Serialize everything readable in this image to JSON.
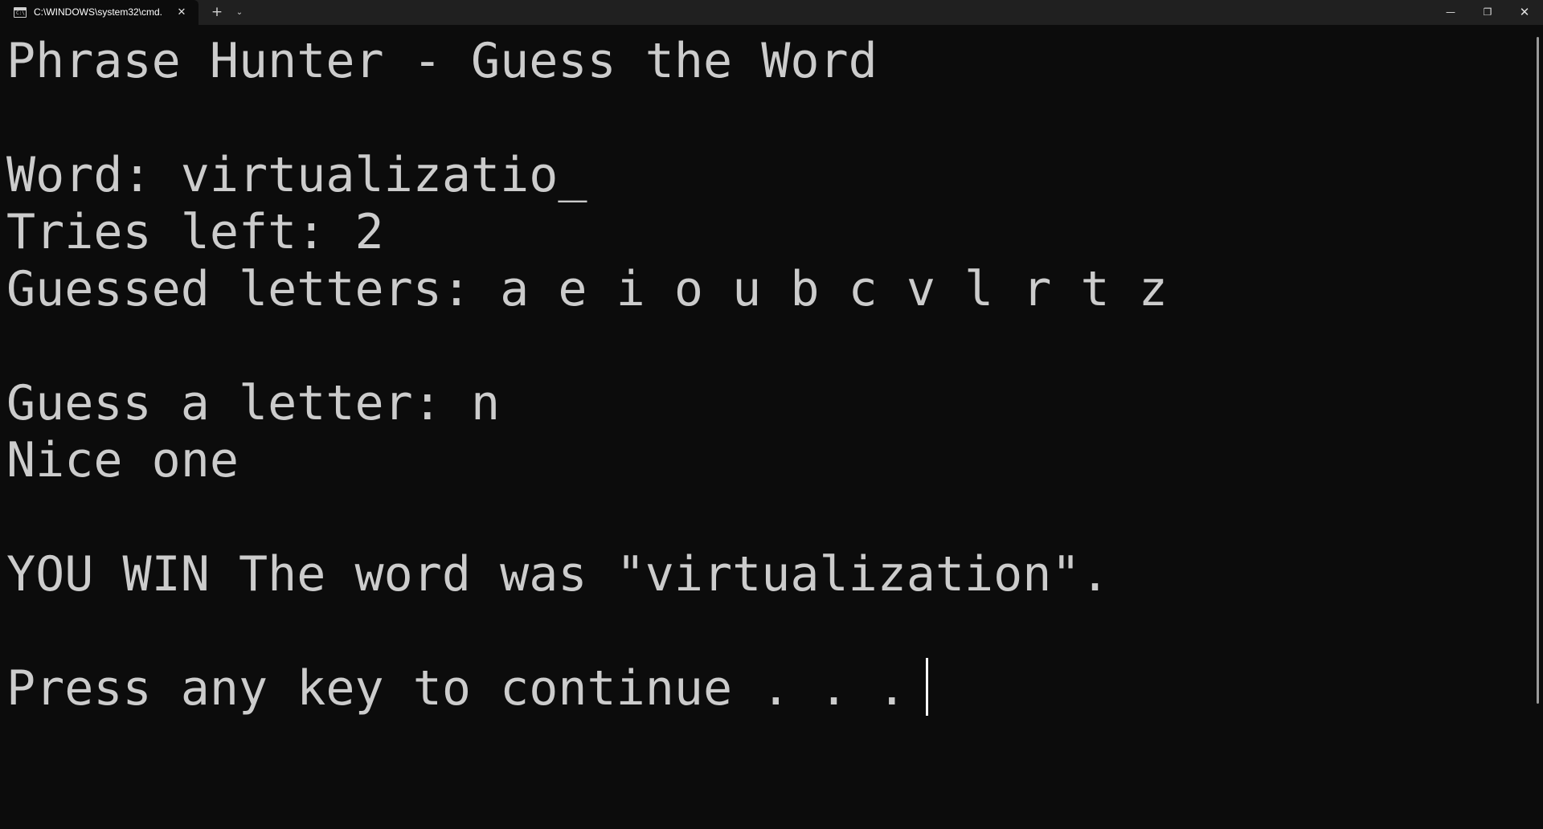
{
  "titlebar": {
    "tab_title": "C:\\WINDOWS\\system32\\cmd.",
    "tab_icon": "cmd-icon",
    "tab_close": "✕",
    "new_tab": "+",
    "dropdown": "⌄",
    "minimize": "—",
    "maximize": "❐",
    "close": "✕"
  },
  "terminal": {
    "title_line": "Phrase Hunter - Guess the Word",
    "word_line": "Word: virtualizatio_",
    "tries_line": "Tries left: 2",
    "guessed_line": "Guessed letters: a e i o u b c v l r t z",
    "prompt_line": "Guess a letter: n",
    "feedback_line": "Nice one",
    "result_line": "YOU WIN The word was \"virtualization\".",
    "continue_line": "Press any key to continue . . . "
  },
  "colors": {
    "background": "#0c0c0c",
    "titlebar": "#202020",
    "text": "#cccccc"
  }
}
